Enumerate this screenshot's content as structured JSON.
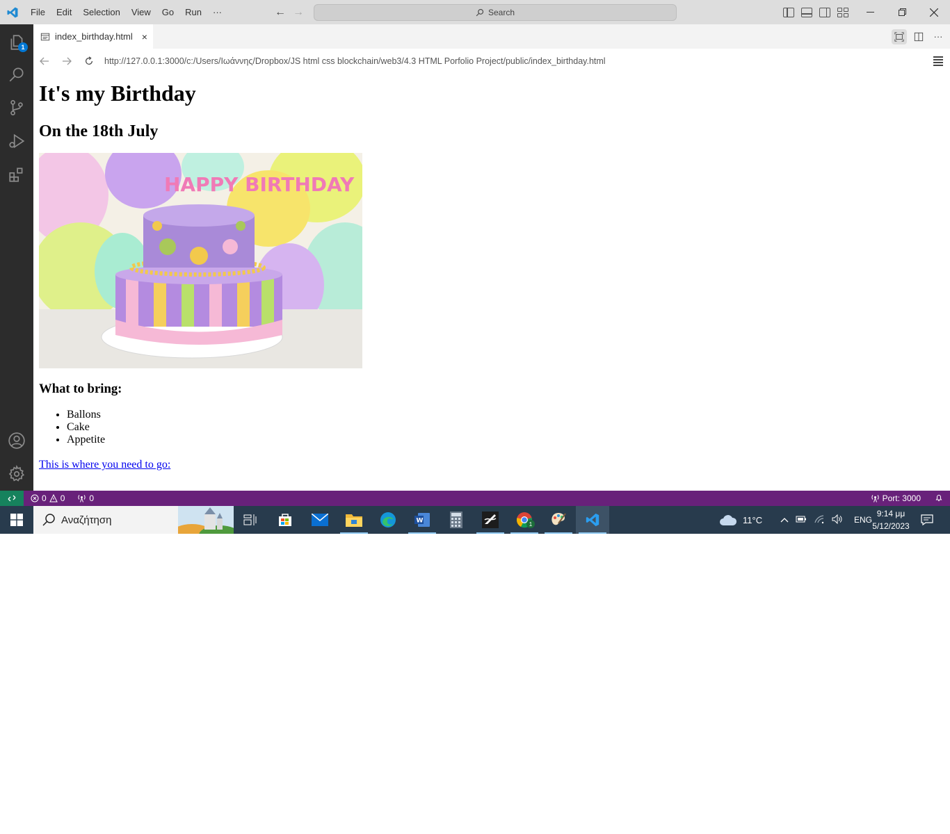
{
  "titlebar": {
    "menu": [
      "File",
      "Edit",
      "Selection",
      "View",
      "Go",
      "Run",
      "···"
    ],
    "search_placeholder": "Search"
  },
  "activitybar": {
    "explorer_badge": "1"
  },
  "tab": {
    "title": "index_birthday.html",
    "close": "×"
  },
  "browser": {
    "url": "http://127.0.0.1:3000/c:/Users/Ιωάννης/Dropbox/JS html css blockchain/web3/4.3 HTML Porfolio Project/public/index_birthday.html"
  },
  "page": {
    "h1": "It's my Birthday",
    "h2": "On the 18th July",
    "image_caption_text": "HAPPY BIRTHDAY",
    "h3": "What to bring:",
    "items": [
      "Ballons",
      "Cake",
      "Appetite"
    ],
    "link": "This is where you need to go:"
  },
  "statusbar": {
    "errors": "0",
    "warnings": "0",
    "ports": "0",
    "port_label": "Port: 3000"
  },
  "taskbar": {
    "search_placeholder": "Αναζήτηση",
    "weather": "11°C",
    "language": "ENG",
    "time": "9:14 μμ",
    "date": "5/12/2023",
    "chrome_badge": "1"
  },
  "colors": {
    "statusbar": "#68217a",
    "remote": "#16825d",
    "activitybar": "#2c2c2c",
    "taskbar": "#283b4d",
    "link": "#0000ee"
  }
}
